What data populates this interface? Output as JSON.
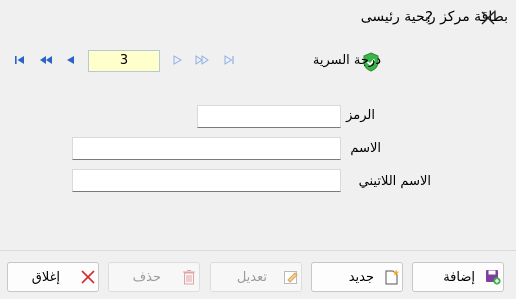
{
  "window": {
    "title": "بطاقة مركز ربحية رئيسى",
    "help_label": "?"
  },
  "navigator": {
    "current_record": "3",
    "icons": [
      "first-icon",
      "prev-page-icon",
      "prev-icon",
      "next-icon",
      "next-page-icon",
      "last-icon"
    ]
  },
  "security": {
    "label": "درجة السرية"
  },
  "form": {
    "code_label": "الرمز",
    "code_value": "",
    "name_label": "الاسم",
    "name_value": "",
    "latin_name_label": "الاسم اللاتيني",
    "latin_name_value": ""
  },
  "buttons": {
    "add": "إضافة",
    "new": "جديد",
    "edit": "تعديل",
    "delete": "حذف",
    "close": "إغلاق"
  },
  "colors": {
    "accent": "#2962c9",
    "record_bg": "#ffffcc",
    "shield": "#3bb54a"
  }
}
